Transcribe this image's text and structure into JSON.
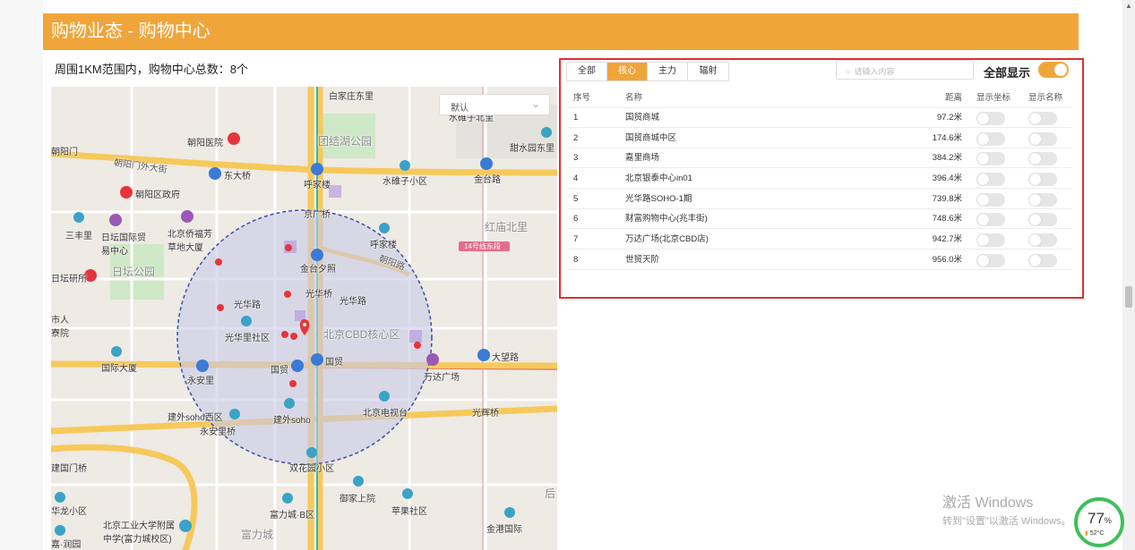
{
  "header": {
    "title": "购物业态 - 购物中心"
  },
  "summary": "周围1KM范围内，购物中心总数：8个",
  "map": {
    "select_value": "默认",
    "labels": {
      "baijiazhuang": "白家庄东里",
      "shuiduo": "水碓子北里",
      "chaoyang_hospital": "朝阳医院",
      "tuanjiehu_park": "团结湖公园",
      "tianshuiyuan": "甜水园东里",
      "chaoyangmen": "朝阳门",
      "chaoyangmenwai": "朝阳门外大街",
      "dongdaqiao": "东大桥",
      "hujialou": "呼家楼",
      "shuiduozixiaoqu": "水碓子小区",
      "jintailu": "金台路",
      "chaoyang_gov": "朝阳区政府",
      "jingguangqiao": "京广桥",
      "hongmiao": "红庙北里",
      "sanfengli": "三丰里",
      "ritan_intl": "日坛国际贸易中心",
      "overseas": "北京侨福芳草地大厦",
      "hujialou2": "呼家楼",
      "line14": "14号线东段",
      "chaoyanglu": "朝阳路",
      "ritan_park": "日坛公园",
      "jinglun": "日坛研所",
      "jintaixizhao": "金台夕照",
      "guanghuaqiao": "光华桥",
      "guanghualu": "光华路",
      "guanghualu2": "光华路",
      "shijiu": "市人寮院",
      "guanghuali": "光华里社区",
      "cbd": "北京CBD核心区",
      "guomao": "国贸",
      "guomao2": "国贸",
      "dawanglu": "大望路",
      "intl_building": "国际大厦",
      "yonganli": "永安里",
      "wanda": "万达广场",
      "jianwai_soho_west": "建外soho西区",
      "jianwai_soho": "建外soho",
      "beijing_tv": "北京电视台",
      "guanghui": "光辉桥",
      "yonganqiao": "永安里桥",
      "shuanghuayuan": "双花园小区",
      "jianguomen": "建国门桥",
      "yujingshang": "御家上院",
      "pingguo": "苹果社区",
      "fuli_b": "富力城·B区",
      "fulicheng": "富力城",
      "hualong": "华龙小区",
      "bjut": "北京工业大学附属中学(富力城校区)",
      "jingang": "金港国际",
      "jiayuan": "嘉·润园",
      "hou": "后"
    }
  },
  "table": {
    "tabs": [
      "全部",
      "核心",
      "主力",
      "辐射"
    ],
    "active_tab": "核心",
    "search_placeholder": "请输入内容",
    "show_all_label": "全部显示",
    "columns": {
      "idx": "序号",
      "name": "名称",
      "dist": "距离",
      "show_coord": "显示坐标",
      "show_name": "显示名称"
    },
    "rows": [
      {
        "idx": "1",
        "name": "国贸商城",
        "dist": "97.2米"
      },
      {
        "idx": "2",
        "name": "国贸商城中区",
        "dist": "174.6米"
      },
      {
        "idx": "3",
        "name": "嘉里商场",
        "dist": "384.2米"
      },
      {
        "idx": "4",
        "name": "北京银泰中心in01",
        "dist": "396.4米"
      },
      {
        "idx": "5",
        "name": "光华路SOHO-1期",
        "dist": "739.8米"
      },
      {
        "idx": "6",
        "name": "财富购物中心(兆丰街)",
        "dist": "748.6米"
      },
      {
        "idx": "7",
        "name": "万达广场(北京CBD店)",
        "dist": "942.7米"
      },
      {
        "idx": "8",
        "name": "世贸天阶",
        "dist": "956.0米"
      }
    ]
  },
  "overlay": {
    "watermark_line1": "激活 Windows",
    "watermark_line2": "转到\"设置\"以激活 Windows。",
    "gauge_percent": "77",
    "gauge_percent_sign": "%",
    "gauge_temp": "52°C"
  },
  "colors": {
    "accent": "#f0a53b",
    "highlight_border": "#e02f2f",
    "marker": "#e6353a",
    "radius_fill": "#c8c9e8"
  }
}
